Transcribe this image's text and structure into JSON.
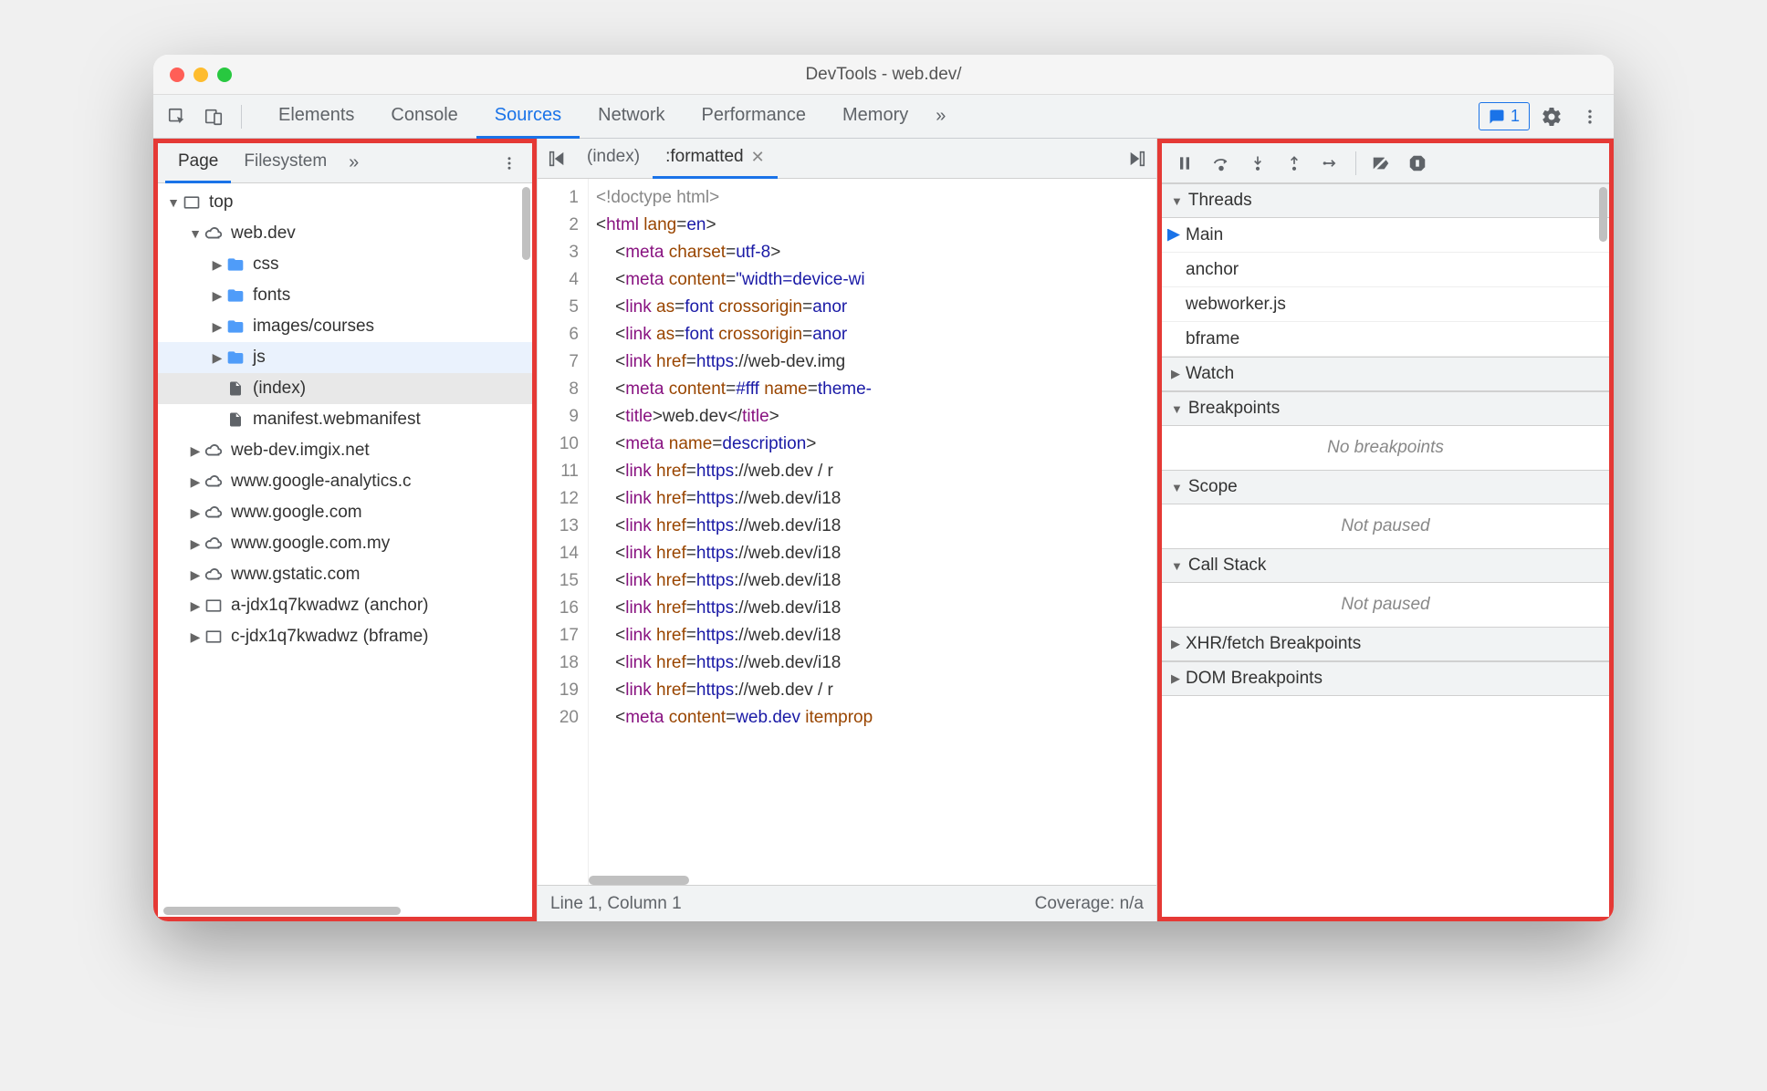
{
  "window": {
    "title": "DevTools - web.dev/"
  },
  "toolbar": {
    "tabs": [
      "Elements",
      "Console",
      "Sources",
      "Network",
      "Performance",
      "Memory"
    ],
    "active_tab": "Sources",
    "more": "»",
    "issues_count": "1"
  },
  "navigator": {
    "tabs": [
      "Page",
      "Filesystem"
    ],
    "active_tab": "Page",
    "more": "»",
    "tree": [
      {
        "depth": 0,
        "expand": "▼",
        "icon": "frame",
        "label": "top"
      },
      {
        "depth": 1,
        "expand": "▼",
        "icon": "cloud",
        "label": "web.dev"
      },
      {
        "depth": 2,
        "expand": "▶",
        "icon": "folder",
        "label": "css"
      },
      {
        "depth": 2,
        "expand": "▶",
        "icon": "folder",
        "label": "fonts"
      },
      {
        "depth": 2,
        "expand": "▶",
        "icon": "folder",
        "label": "images/courses"
      },
      {
        "depth": 2,
        "expand": "▶",
        "icon": "folder",
        "label": "js",
        "hover": true
      },
      {
        "depth": 2,
        "expand": "",
        "icon": "file",
        "label": "(index)",
        "selected": true
      },
      {
        "depth": 2,
        "expand": "",
        "icon": "file",
        "label": "manifest.webmanifest"
      },
      {
        "depth": 1,
        "expand": "▶",
        "icon": "cloud",
        "label": "web-dev.imgix.net"
      },
      {
        "depth": 1,
        "expand": "▶",
        "icon": "cloud",
        "label": "www.google-analytics.c"
      },
      {
        "depth": 1,
        "expand": "▶",
        "icon": "cloud",
        "label": "www.google.com"
      },
      {
        "depth": 1,
        "expand": "▶",
        "icon": "cloud",
        "label": "www.google.com.my"
      },
      {
        "depth": 1,
        "expand": "▶",
        "icon": "cloud",
        "label": "www.gstatic.com"
      },
      {
        "depth": 1,
        "expand": "▶",
        "icon": "frame",
        "label": "a-jdx1q7kwadwz (anchor)"
      },
      {
        "depth": 1,
        "expand": "▶",
        "icon": "frame",
        "label": "c-jdx1q7kwadwz (bframe)"
      }
    ]
  },
  "editor": {
    "tabs": [
      {
        "label": "(index)",
        "closable": false,
        "active": false
      },
      {
        "label": ":formatted",
        "closable": true,
        "active": true
      }
    ],
    "lines": [
      [
        {
          "t": "doctype",
          "v": "<!doctype html>"
        }
      ],
      [
        {
          "t": "punct",
          "v": "<"
        },
        {
          "t": "tag",
          "v": "html"
        },
        {
          "t": "txt",
          "v": " "
        },
        {
          "t": "attr",
          "v": "lang"
        },
        {
          "t": "punct",
          "v": "="
        },
        {
          "t": "val",
          "v": "en"
        },
        {
          "t": "punct",
          "v": ">"
        }
      ],
      [
        {
          "t": "txt",
          "v": "    "
        },
        {
          "t": "punct",
          "v": "<"
        },
        {
          "t": "tag",
          "v": "meta"
        },
        {
          "t": "txt",
          "v": " "
        },
        {
          "t": "attr",
          "v": "charset"
        },
        {
          "t": "punct",
          "v": "="
        },
        {
          "t": "val",
          "v": "utf-8"
        },
        {
          "t": "punct",
          "v": ">"
        }
      ],
      [
        {
          "t": "txt",
          "v": "    "
        },
        {
          "t": "punct",
          "v": "<"
        },
        {
          "t": "tag",
          "v": "meta"
        },
        {
          "t": "txt",
          "v": " "
        },
        {
          "t": "attr",
          "v": "content"
        },
        {
          "t": "punct",
          "v": "="
        },
        {
          "t": "val",
          "v": "\"width=device-wi"
        }
      ],
      [
        {
          "t": "txt",
          "v": "    "
        },
        {
          "t": "punct",
          "v": "<"
        },
        {
          "t": "tag",
          "v": "link"
        },
        {
          "t": "txt",
          "v": " "
        },
        {
          "t": "attr",
          "v": "as"
        },
        {
          "t": "punct",
          "v": "="
        },
        {
          "t": "val",
          "v": "font"
        },
        {
          "t": "txt",
          "v": " "
        },
        {
          "t": "attr",
          "v": "crossorigin"
        },
        {
          "t": "punct",
          "v": "="
        },
        {
          "t": "val",
          "v": "anor"
        }
      ],
      [
        {
          "t": "txt",
          "v": "    "
        },
        {
          "t": "punct",
          "v": "<"
        },
        {
          "t": "tag",
          "v": "link"
        },
        {
          "t": "txt",
          "v": " "
        },
        {
          "t": "attr",
          "v": "as"
        },
        {
          "t": "punct",
          "v": "="
        },
        {
          "t": "val",
          "v": "font"
        },
        {
          "t": "txt",
          "v": " "
        },
        {
          "t": "attr",
          "v": "crossorigin"
        },
        {
          "t": "punct",
          "v": "="
        },
        {
          "t": "val",
          "v": "anor"
        }
      ],
      [
        {
          "t": "txt",
          "v": "    "
        },
        {
          "t": "punct",
          "v": "<"
        },
        {
          "t": "tag",
          "v": "link"
        },
        {
          "t": "txt",
          "v": " "
        },
        {
          "t": "attr",
          "v": "href"
        },
        {
          "t": "punct",
          "v": "="
        },
        {
          "t": "val",
          "v": "https"
        },
        {
          "t": "txt",
          "v": "://web-dev.img"
        }
      ],
      [
        {
          "t": "txt",
          "v": "    "
        },
        {
          "t": "punct",
          "v": "<"
        },
        {
          "t": "tag",
          "v": "meta"
        },
        {
          "t": "txt",
          "v": " "
        },
        {
          "t": "attr",
          "v": "content"
        },
        {
          "t": "punct",
          "v": "="
        },
        {
          "t": "val",
          "v": "#fff"
        },
        {
          "t": "txt",
          "v": " "
        },
        {
          "t": "attr",
          "v": "name"
        },
        {
          "t": "punct",
          "v": "="
        },
        {
          "t": "val",
          "v": "theme-"
        }
      ],
      [
        {
          "t": "txt",
          "v": "    "
        },
        {
          "t": "punct",
          "v": "<"
        },
        {
          "t": "tag",
          "v": "title"
        },
        {
          "t": "punct",
          "v": ">"
        },
        {
          "t": "txt",
          "v": "web.dev"
        },
        {
          "t": "punct",
          "v": "</"
        },
        {
          "t": "tag",
          "v": "title"
        },
        {
          "t": "punct",
          "v": ">"
        }
      ],
      [
        {
          "t": "txt",
          "v": "    "
        },
        {
          "t": "punct",
          "v": "<"
        },
        {
          "t": "tag",
          "v": "meta"
        },
        {
          "t": "txt",
          "v": " "
        },
        {
          "t": "attr",
          "v": "name"
        },
        {
          "t": "punct",
          "v": "="
        },
        {
          "t": "val",
          "v": "description"
        },
        {
          "t": "punct",
          "v": ">"
        }
      ],
      [
        {
          "t": "txt",
          "v": "    "
        },
        {
          "t": "punct",
          "v": "<"
        },
        {
          "t": "tag",
          "v": "link"
        },
        {
          "t": "txt",
          "v": " "
        },
        {
          "t": "attr",
          "v": "href"
        },
        {
          "t": "punct",
          "v": "="
        },
        {
          "t": "val",
          "v": "https"
        },
        {
          "t": "txt",
          "v": "://web.dev / r"
        }
      ],
      [
        {
          "t": "txt",
          "v": "    "
        },
        {
          "t": "punct",
          "v": "<"
        },
        {
          "t": "tag",
          "v": "link"
        },
        {
          "t": "txt",
          "v": " "
        },
        {
          "t": "attr",
          "v": "href"
        },
        {
          "t": "punct",
          "v": "="
        },
        {
          "t": "val",
          "v": "https"
        },
        {
          "t": "txt",
          "v": "://web.dev/i18"
        }
      ],
      [
        {
          "t": "txt",
          "v": "    "
        },
        {
          "t": "punct",
          "v": "<"
        },
        {
          "t": "tag",
          "v": "link"
        },
        {
          "t": "txt",
          "v": " "
        },
        {
          "t": "attr",
          "v": "href"
        },
        {
          "t": "punct",
          "v": "="
        },
        {
          "t": "val",
          "v": "https"
        },
        {
          "t": "txt",
          "v": "://web.dev/i18"
        }
      ],
      [
        {
          "t": "txt",
          "v": "    "
        },
        {
          "t": "punct",
          "v": "<"
        },
        {
          "t": "tag",
          "v": "link"
        },
        {
          "t": "txt",
          "v": " "
        },
        {
          "t": "attr",
          "v": "href"
        },
        {
          "t": "punct",
          "v": "="
        },
        {
          "t": "val",
          "v": "https"
        },
        {
          "t": "txt",
          "v": "://web.dev/i18"
        }
      ],
      [
        {
          "t": "txt",
          "v": "    "
        },
        {
          "t": "punct",
          "v": "<"
        },
        {
          "t": "tag",
          "v": "link"
        },
        {
          "t": "txt",
          "v": " "
        },
        {
          "t": "attr",
          "v": "href"
        },
        {
          "t": "punct",
          "v": "="
        },
        {
          "t": "val",
          "v": "https"
        },
        {
          "t": "txt",
          "v": "://web.dev/i18"
        }
      ],
      [
        {
          "t": "txt",
          "v": "    "
        },
        {
          "t": "punct",
          "v": "<"
        },
        {
          "t": "tag",
          "v": "link"
        },
        {
          "t": "txt",
          "v": " "
        },
        {
          "t": "attr",
          "v": "href"
        },
        {
          "t": "punct",
          "v": "="
        },
        {
          "t": "val",
          "v": "https"
        },
        {
          "t": "txt",
          "v": "://web.dev/i18"
        }
      ],
      [
        {
          "t": "txt",
          "v": "    "
        },
        {
          "t": "punct",
          "v": "<"
        },
        {
          "t": "tag",
          "v": "link"
        },
        {
          "t": "txt",
          "v": " "
        },
        {
          "t": "attr",
          "v": "href"
        },
        {
          "t": "punct",
          "v": "="
        },
        {
          "t": "val",
          "v": "https"
        },
        {
          "t": "txt",
          "v": "://web.dev/i18"
        }
      ],
      [
        {
          "t": "txt",
          "v": "    "
        },
        {
          "t": "punct",
          "v": "<"
        },
        {
          "t": "tag",
          "v": "link"
        },
        {
          "t": "txt",
          "v": " "
        },
        {
          "t": "attr",
          "v": "href"
        },
        {
          "t": "punct",
          "v": "="
        },
        {
          "t": "val",
          "v": "https"
        },
        {
          "t": "txt",
          "v": "://web.dev/i18"
        }
      ],
      [
        {
          "t": "txt",
          "v": "    "
        },
        {
          "t": "punct",
          "v": "<"
        },
        {
          "t": "tag",
          "v": "link"
        },
        {
          "t": "txt",
          "v": " "
        },
        {
          "t": "attr",
          "v": "href"
        },
        {
          "t": "punct",
          "v": "="
        },
        {
          "t": "val",
          "v": "https"
        },
        {
          "t": "txt",
          "v": "://web.dev / r"
        }
      ],
      [
        {
          "t": "txt",
          "v": "    "
        },
        {
          "t": "punct",
          "v": "<"
        },
        {
          "t": "tag",
          "v": "meta"
        },
        {
          "t": "txt",
          "v": " "
        },
        {
          "t": "attr",
          "v": "content"
        },
        {
          "t": "punct",
          "v": "="
        },
        {
          "t": "val",
          "v": "web.dev"
        },
        {
          "t": "txt",
          "v": " "
        },
        {
          "t": "attr",
          "v": "itemprop"
        }
      ]
    ],
    "statusbar": {
      "position": "Line 1, Column 1",
      "coverage": "Coverage: n/a"
    }
  },
  "debugger": {
    "sections": {
      "threads": {
        "label": "Threads",
        "expanded": true,
        "items": [
          "Main",
          "anchor",
          "webworker.js",
          "bframe"
        ],
        "active": "Main"
      },
      "watch": {
        "label": "Watch",
        "expanded": false
      },
      "breakpoints": {
        "label": "Breakpoints",
        "expanded": true,
        "placeholder": "No breakpoints"
      },
      "scope": {
        "label": "Scope",
        "expanded": true,
        "placeholder": "Not paused"
      },
      "callstack": {
        "label": "Call Stack",
        "expanded": true,
        "placeholder": "Not paused"
      },
      "xhr": {
        "label": "XHR/fetch Breakpoints",
        "expanded": false
      },
      "dom": {
        "label": "DOM Breakpoints",
        "expanded": false
      }
    }
  }
}
